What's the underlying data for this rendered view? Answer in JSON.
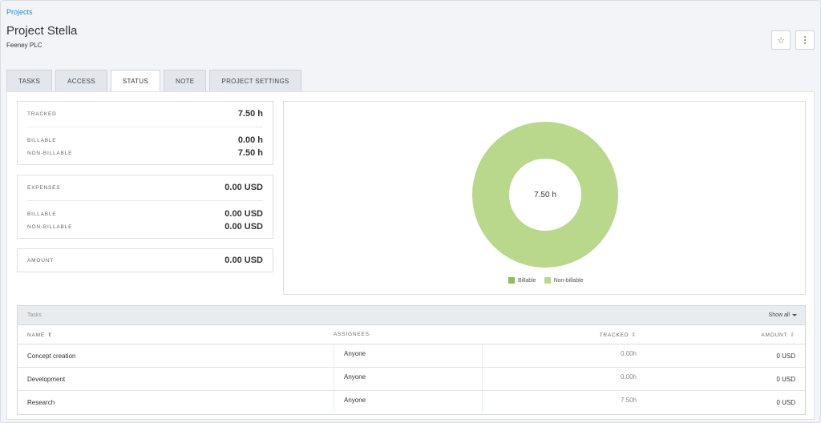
{
  "breadcrumb": {
    "label": "Projects"
  },
  "project": {
    "title": "Project Stella",
    "client": "Feeney PLC"
  },
  "icons": {
    "star": "star-icon",
    "more": "more-vertical-icon"
  },
  "tabs": [
    {
      "label": "TASKS"
    },
    {
      "label": "ACCESS"
    },
    {
      "label": "STATUS",
      "active": true
    },
    {
      "label": "NOTE"
    },
    {
      "label": "PROJECT SETTINGS"
    }
  ],
  "summary": {
    "tracked": {
      "label": "TRACKED",
      "value": "7.50 h"
    },
    "tracked_billable": {
      "label": "BILLABLE",
      "value": "0.00 h"
    },
    "tracked_nonbillable": {
      "label": "NON-BILLABLE",
      "value": "7.50 h"
    },
    "expenses": {
      "label": "EXPENSES",
      "value": "0.00 USD"
    },
    "expenses_billable": {
      "label": "BILLABLE",
      "value": "0.00 USD"
    },
    "expenses_nonbillable": {
      "label": "NON-BILLABLE",
      "value": "0.00 USD"
    },
    "amount": {
      "label": "AMOUNT",
      "value": "0.00 USD"
    }
  },
  "colors": {
    "billable": "#8fbd56",
    "non_billable": "#b9d88b",
    "link": "#2b8ad6"
  },
  "chart_data": {
    "type": "pie",
    "center_label": "7.50 h",
    "categories": [
      "Billable",
      "Non-billable"
    ],
    "values": [
      0,
      7.5
    ],
    "colors": [
      "#8fbd56",
      "#b9d88b"
    ],
    "legend": "bottom"
  },
  "tasks": {
    "search_placeholder": "Tasks",
    "show_all": "Show all",
    "columns": {
      "name": "NAME",
      "assignees": "ASSIGNEES",
      "tracked": "TRACKED",
      "amount": "AMOUNT"
    },
    "rows": [
      {
        "name": "Concept creation",
        "assignee": "Anyone",
        "tracked": "0.00h",
        "amount": "0 USD"
      },
      {
        "name": "Development",
        "assignee": "Anyone",
        "tracked": "0.00h",
        "amount": "0 USD"
      },
      {
        "name": "Research",
        "assignee": "Anyone",
        "tracked": "7.50h",
        "amount": "0 USD"
      }
    ]
  }
}
